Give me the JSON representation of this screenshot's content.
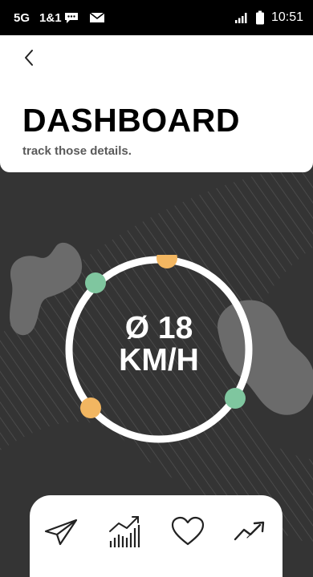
{
  "status_bar": {
    "network": "5G",
    "carrier": "1&1",
    "time": "10:51",
    "icons": [
      "chat-bubble-icon",
      "mail-icon",
      "signal-icon",
      "battery-icon"
    ]
  },
  "header": {
    "back_icon": "chevron-left-icon",
    "title": "DASHBOARD",
    "subtitle": "track those details."
  },
  "gauge": {
    "readout_line1": "Ø 18",
    "readout_line2": "KM/H",
    "markers": [
      {
        "color": "#f2b661",
        "kind": "orange"
      },
      {
        "color": "#7fc69f",
        "kind": "green"
      }
    ]
  },
  "bottom_nav": {
    "items": [
      "send-icon",
      "bar-chart-icon",
      "heart-icon",
      "trend-up-icon"
    ]
  },
  "colors": {
    "background": "#343434",
    "accent_orange": "#f2b661",
    "accent_green": "#7fc69f",
    "card": "#ffffff",
    "blob": "#6b6b6b"
  }
}
